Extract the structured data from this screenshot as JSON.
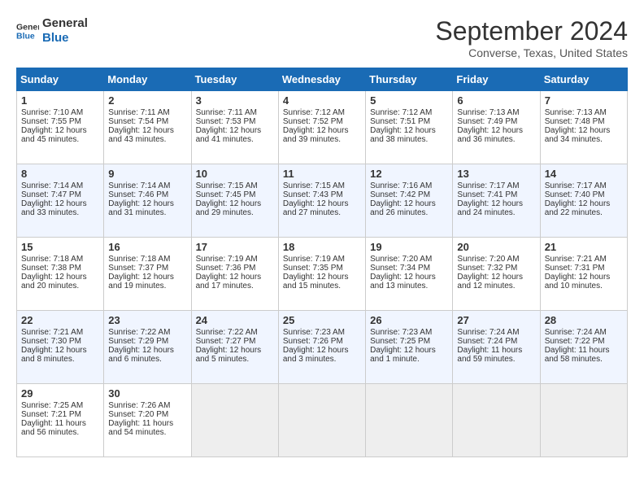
{
  "header": {
    "logo_line1": "General",
    "logo_line2": "Blue",
    "month": "September 2024",
    "location": "Converse, Texas, United States"
  },
  "days_of_week": [
    "Sunday",
    "Monday",
    "Tuesday",
    "Wednesday",
    "Thursday",
    "Friday",
    "Saturday"
  ],
  "weeks": [
    [
      {
        "day": 1,
        "lines": [
          "Sunrise: 7:10 AM",
          "Sunset: 7:55 PM",
          "Daylight: 12 hours",
          "and 45 minutes."
        ]
      },
      {
        "day": 2,
        "lines": [
          "Sunrise: 7:11 AM",
          "Sunset: 7:54 PM",
          "Daylight: 12 hours",
          "and 43 minutes."
        ]
      },
      {
        "day": 3,
        "lines": [
          "Sunrise: 7:11 AM",
          "Sunset: 7:53 PM",
          "Daylight: 12 hours",
          "and 41 minutes."
        ]
      },
      {
        "day": 4,
        "lines": [
          "Sunrise: 7:12 AM",
          "Sunset: 7:52 PM",
          "Daylight: 12 hours",
          "and 39 minutes."
        ]
      },
      {
        "day": 5,
        "lines": [
          "Sunrise: 7:12 AM",
          "Sunset: 7:51 PM",
          "Daylight: 12 hours",
          "and 38 minutes."
        ]
      },
      {
        "day": 6,
        "lines": [
          "Sunrise: 7:13 AM",
          "Sunset: 7:49 PM",
          "Daylight: 12 hours",
          "and 36 minutes."
        ]
      },
      {
        "day": 7,
        "lines": [
          "Sunrise: 7:13 AM",
          "Sunset: 7:48 PM",
          "Daylight: 12 hours",
          "and 34 minutes."
        ]
      }
    ],
    [
      {
        "day": 8,
        "lines": [
          "Sunrise: 7:14 AM",
          "Sunset: 7:47 PM",
          "Daylight: 12 hours",
          "and 33 minutes."
        ]
      },
      {
        "day": 9,
        "lines": [
          "Sunrise: 7:14 AM",
          "Sunset: 7:46 PM",
          "Daylight: 12 hours",
          "and 31 minutes."
        ]
      },
      {
        "day": 10,
        "lines": [
          "Sunrise: 7:15 AM",
          "Sunset: 7:45 PM",
          "Daylight: 12 hours",
          "and 29 minutes."
        ]
      },
      {
        "day": 11,
        "lines": [
          "Sunrise: 7:15 AM",
          "Sunset: 7:43 PM",
          "Daylight: 12 hours",
          "and 27 minutes."
        ]
      },
      {
        "day": 12,
        "lines": [
          "Sunrise: 7:16 AM",
          "Sunset: 7:42 PM",
          "Daylight: 12 hours",
          "and 26 minutes."
        ]
      },
      {
        "day": 13,
        "lines": [
          "Sunrise: 7:17 AM",
          "Sunset: 7:41 PM",
          "Daylight: 12 hours",
          "and 24 minutes."
        ]
      },
      {
        "day": 14,
        "lines": [
          "Sunrise: 7:17 AM",
          "Sunset: 7:40 PM",
          "Daylight: 12 hours",
          "and 22 minutes."
        ]
      }
    ],
    [
      {
        "day": 15,
        "lines": [
          "Sunrise: 7:18 AM",
          "Sunset: 7:38 PM",
          "Daylight: 12 hours",
          "and 20 minutes."
        ]
      },
      {
        "day": 16,
        "lines": [
          "Sunrise: 7:18 AM",
          "Sunset: 7:37 PM",
          "Daylight: 12 hours",
          "and 19 minutes."
        ]
      },
      {
        "day": 17,
        "lines": [
          "Sunrise: 7:19 AM",
          "Sunset: 7:36 PM",
          "Daylight: 12 hours",
          "and 17 minutes."
        ]
      },
      {
        "day": 18,
        "lines": [
          "Sunrise: 7:19 AM",
          "Sunset: 7:35 PM",
          "Daylight: 12 hours",
          "and 15 minutes."
        ]
      },
      {
        "day": 19,
        "lines": [
          "Sunrise: 7:20 AM",
          "Sunset: 7:34 PM",
          "Daylight: 12 hours",
          "and 13 minutes."
        ]
      },
      {
        "day": 20,
        "lines": [
          "Sunrise: 7:20 AM",
          "Sunset: 7:32 PM",
          "Daylight: 12 hours",
          "and 12 minutes."
        ]
      },
      {
        "day": 21,
        "lines": [
          "Sunrise: 7:21 AM",
          "Sunset: 7:31 PM",
          "Daylight: 12 hours",
          "and 10 minutes."
        ]
      }
    ],
    [
      {
        "day": 22,
        "lines": [
          "Sunrise: 7:21 AM",
          "Sunset: 7:30 PM",
          "Daylight: 12 hours",
          "and 8 minutes."
        ]
      },
      {
        "day": 23,
        "lines": [
          "Sunrise: 7:22 AM",
          "Sunset: 7:29 PM",
          "Daylight: 12 hours",
          "and 6 minutes."
        ]
      },
      {
        "day": 24,
        "lines": [
          "Sunrise: 7:22 AM",
          "Sunset: 7:27 PM",
          "Daylight: 12 hours",
          "and 5 minutes."
        ]
      },
      {
        "day": 25,
        "lines": [
          "Sunrise: 7:23 AM",
          "Sunset: 7:26 PM",
          "Daylight: 12 hours",
          "and 3 minutes."
        ]
      },
      {
        "day": 26,
        "lines": [
          "Sunrise: 7:23 AM",
          "Sunset: 7:25 PM",
          "Daylight: 12 hours",
          "and 1 minute."
        ]
      },
      {
        "day": 27,
        "lines": [
          "Sunrise: 7:24 AM",
          "Sunset: 7:24 PM",
          "Daylight: 11 hours",
          "and 59 minutes."
        ]
      },
      {
        "day": 28,
        "lines": [
          "Sunrise: 7:24 AM",
          "Sunset: 7:22 PM",
          "Daylight: 11 hours",
          "and 58 minutes."
        ]
      }
    ],
    [
      {
        "day": 29,
        "lines": [
          "Sunrise: 7:25 AM",
          "Sunset: 7:21 PM",
          "Daylight: 11 hours",
          "and 56 minutes."
        ]
      },
      {
        "day": 30,
        "lines": [
          "Sunrise: 7:26 AM",
          "Sunset: 7:20 PM",
          "Daylight: 11 hours",
          "and 54 minutes."
        ]
      },
      null,
      null,
      null,
      null,
      null
    ]
  ]
}
